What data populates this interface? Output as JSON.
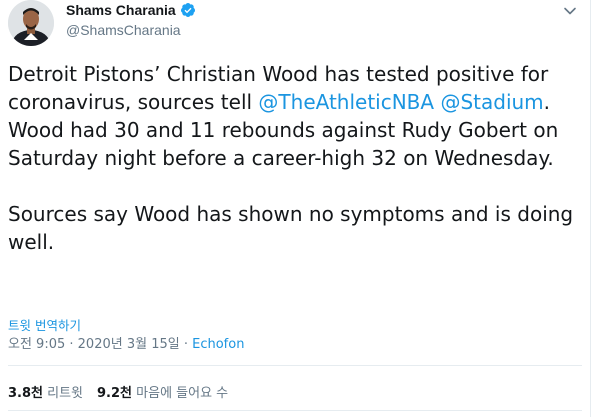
{
  "author": {
    "name": "Shams Charania",
    "handle": "@ShamsCharania",
    "avatar_icon": "user-avatar",
    "verified_icon": "verified-badge-icon"
  },
  "tweet": {
    "p1_part1": "Detroit Pistons’ Christian Wood has tested positive for coronavirus, sources tell ",
    "mention1": "@TheAthleticNBA",
    "p1_part2": " ",
    "mention2": "@Stadium",
    "p1_part3": ". Wood had 30 and 11 rebounds against Rudy Gobert on Saturday night before a career-high 32 on Wednesday.",
    "p2": "Sources say Wood has shown no symptoms and is doing well."
  },
  "translate_label": "트윗 번역하기",
  "meta": {
    "time": "오전 9:05",
    "separator1": " · ",
    "date": "2020년 3월 15일",
    "separator2": " · ",
    "source": "Echofon"
  },
  "stats": {
    "retweets_count": "3.8천",
    "retweets_label": " 리트윗",
    "likes_count": "9.2천",
    "likes_label": " 마음에 들어요 수"
  },
  "colors": {
    "link": "#1b95e0",
    "text": "#14171a",
    "muted": "#657786",
    "divider": "#e6ecf0"
  }
}
